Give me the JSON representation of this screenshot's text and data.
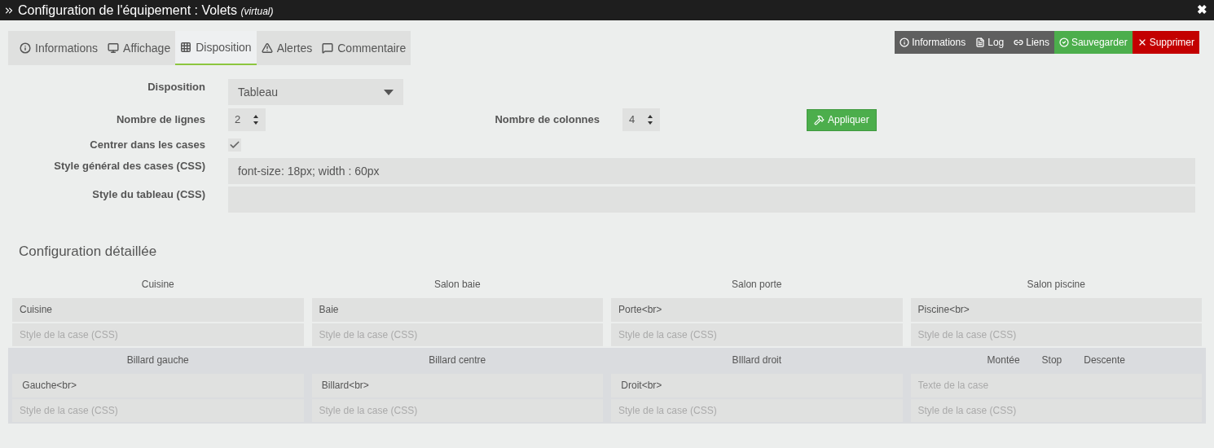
{
  "window": {
    "title": "Configuration de l'équipement : Volets",
    "subtitle": "(virtual)",
    "close": "✖"
  },
  "tabs": [
    {
      "label": "Informations",
      "selected": false
    },
    {
      "label": "Affichage",
      "selected": false
    },
    {
      "label": "Disposition",
      "selected": true
    },
    {
      "label": "Alertes",
      "selected": false
    },
    {
      "label": "Commentaire",
      "selected": false
    }
  ],
  "actions": [
    {
      "label": "Informations",
      "kind": "default"
    },
    {
      "label": "Log",
      "kind": "default"
    },
    {
      "label": "Liens",
      "kind": "default"
    },
    {
      "label": "Sauvegarder",
      "kind": "success"
    },
    {
      "label": "Supprimer",
      "kind": "danger"
    }
  ],
  "form": {
    "disposition": {
      "label": "Disposition",
      "value": "Tableau"
    },
    "rows": {
      "label": "Nombre de lignes",
      "value": "2"
    },
    "columns": {
      "label": "Nombre de colonnes",
      "value": "4"
    },
    "apply": "Appliquer",
    "center": {
      "label": "Centrer dans les cases",
      "checked": true
    },
    "cell_style": {
      "label": "Style général des cases (CSS)",
      "value": "font-size: 18px; width : 60px"
    },
    "table_style": {
      "label": "Style du tableau (CSS)"
    }
  },
  "detail": {
    "title": "Configuration détaillée",
    "rows": [
      {
        "highlighted": false,
        "cells": [
          {
            "header": [
              "Cuisine"
            ],
            "text": "Cuisine",
            "style_placeholder": "Style de la case (CSS)"
          },
          {
            "header": [
              "Salon baie"
            ],
            "text": "Baie",
            "style_placeholder": "Style de la case (CSS)"
          },
          {
            "header": [
              "Salon porte"
            ],
            "text": "Porte<br>",
            "style_placeholder": "Style de la case (CSS)"
          },
          {
            "header": [
              "Salon piscine"
            ],
            "text": "Piscine<br>",
            "style_placeholder": "Style de la case (CSS)"
          }
        ]
      },
      {
        "highlighted": true,
        "cells": [
          {
            "header": [
              "Billard gauche"
            ],
            "text": " Gauche<br>",
            "style_placeholder": "Style de la case (CSS)"
          },
          {
            "header": [
              "Billard centre"
            ],
            "text": " Billard<br>",
            "style_placeholder": "Style de la case (CSS)"
          },
          {
            "header": [
              "BIllard droit"
            ],
            "text": " Droit<br>",
            "style_placeholder": "Style de la case (CSS)"
          },
          {
            "header": [
              "Montée",
              "Stop",
              "Descente"
            ],
            "text_placeholder": "Texte de la case",
            "style_placeholder": "Style de la case (CSS)"
          }
        ]
      }
    ]
  }
}
